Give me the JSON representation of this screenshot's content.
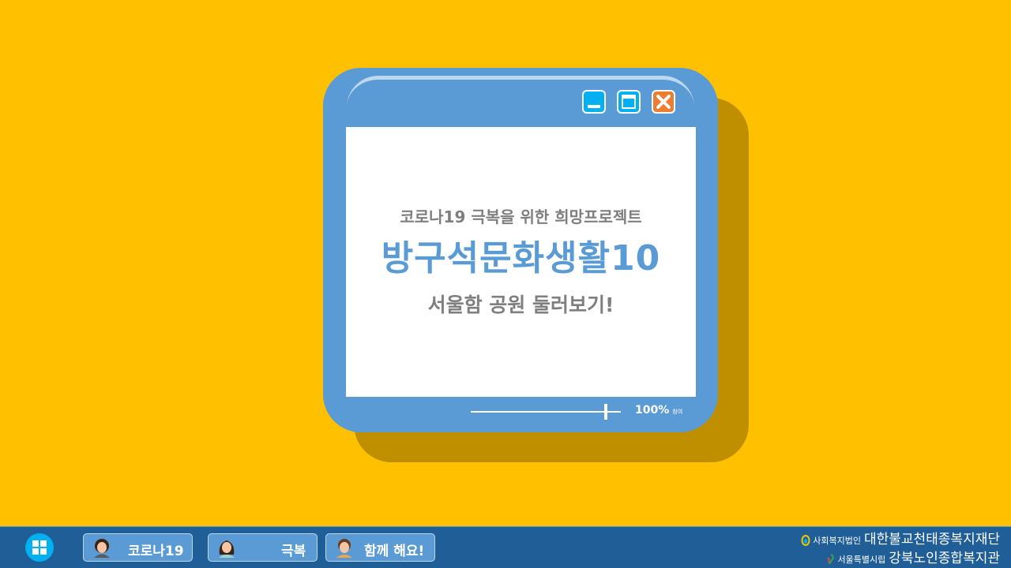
{
  "window": {
    "subtitle": "코로나19 극복을 위한 희망프로젝트",
    "title": "방구석문화생활10",
    "caption": "서울함 공원 둘러보기!",
    "zoom": {
      "level": 1.0,
      "label": "100%",
      "unit": "참여"
    },
    "controls": [
      "minimize-icon",
      "maximize-icon",
      "close-icon"
    ]
  },
  "taskbar": {
    "start_icon": "windows-logo-icon",
    "items": [
      {
        "label": "코로나19",
        "icon": "person-avatar-icon"
      },
      {
        "label": "극복",
        "icon": "person-avatar-icon"
      },
      {
        "label": "함께 해요!",
        "icon": "person-avatar-icon"
      }
    ],
    "org": {
      "line1_prefix": "사회복지법인",
      "line1_name": "대한불교천태종복지재단",
      "line2_prefix": "서울특별시립",
      "line2_name": "강북노인종합복지관"
    }
  },
  "colors": {
    "background": "#FFC000",
    "shadow": "#BF8F00",
    "window": "#5B9BD5",
    "taskbar": "#1F5E96",
    "accent_blue": "#00B0F0",
    "close_orange": "#ED7D31",
    "text_gray": "#7F7F7F"
  }
}
